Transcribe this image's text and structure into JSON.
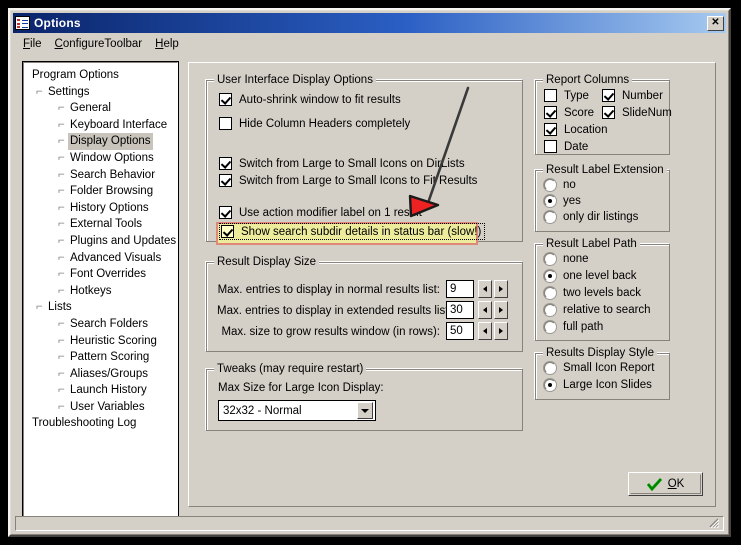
{
  "window": {
    "title": "Options",
    "icon": "options-list-icon",
    "close_label": "✕"
  },
  "menubar": {
    "items": [
      {
        "label": "File",
        "accel": "F"
      },
      {
        "label": "ConfigureToolbar",
        "accel": "C"
      },
      {
        "label": "Help",
        "accel": "H"
      }
    ]
  },
  "tree": {
    "nodes": [
      {
        "label": "Program Options",
        "level": 0,
        "selected": false
      },
      {
        "label": "Settings",
        "level": 1,
        "selected": false
      },
      {
        "label": "General",
        "level": 2,
        "selected": false
      },
      {
        "label": "Keyboard Interface",
        "level": 2,
        "selected": false
      },
      {
        "label": "Display Options",
        "level": 2,
        "selected": true
      },
      {
        "label": "Window Options",
        "level": 2,
        "selected": false
      },
      {
        "label": "Search Behavior",
        "level": 2,
        "selected": false
      },
      {
        "label": "Folder Browsing",
        "level": 2,
        "selected": false
      },
      {
        "label": "History Options",
        "level": 2,
        "selected": false
      },
      {
        "label": "External Tools",
        "level": 2,
        "selected": false
      },
      {
        "label": "Plugins and Updates",
        "level": 2,
        "selected": false
      },
      {
        "label": "Advanced Visuals",
        "level": 2,
        "selected": false
      },
      {
        "label": "Font Overrides",
        "level": 2,
        "selected": false
      },
      {
        "label": "Hotkeys",
        "level": 2,
        "selected": false
      },
      {
        "label": "Lists",
        "level": 1,
        "selected": false
      },
      {
        "label": "Search Folders",
        "level": 2,
        "selected": false
      },
      {
        "label": "Heuristic Scoring",
        "level": 2,
        "selected": false
      },
      {
        "label": "Pattern Scoring",
        "level": 2,
        "selected": false
      },
      {
        "label": "Aliases/Groups",
        "level": 2,
        "selected": false
      },
      {
        "label": "Launch History",
        "level": 2,
        "selected": false
      },
      {
        "label": "User Variables",
        "level": 2,
        "selected": false
      },
      {
        "label": "Troubleshooting Log",
        "level": 0,
        "selected": false
      }
    ]
  },
  "ui_display_options": {
    "caption": "User Interface Display Options",
    "checkboxes": [
      {
        "label": "Auto-shrink window to fit results",
        "checked": true
      },
      {
        "label": "Hide Column Headers completely",
        "checked": false
      },
      {
        "label": "Switch from Large to Small Icons on DirLists",
        "checked": true
      },
      {
        "label": "Switch from Large to Small Icons to Fit Results",
        "checked": true
      },
      {
        "label": "Use action modifier label on 1 result",
        "checked": true
      }
    ],
    "highlighted_option": {
      "label": "Show search subdir details in status bar (slow!)",
      "checked": true,
      "highlight_fill": "#ecec9c",
      "highlight_border": "#e08878"
    }
  },
  "result_display_size": {
    "caption": "Result Display Size",
    "fields": [
      {
        "label": "Max. entries to display in normal results list:",
        "value": "9"
      },
      {
        "label": "Max. entries to display in extended results list:",
        "value": "30"
      },
      {
        "label": "Max. size to grow results window (in rows):",
        "value": "50"
      }
    ]
  },
  "tweaks": {
    "caption": "Tweaks (may require restart)",
    "label": "Max Size for Large Icon Display:",
    "combo_value": "32x32 - Normal"
  },
  "report_columns": {
    "caption": "Report Columns",
    "items": [
      {
        "label": "Type",
        "checked": false
      },
      {
        "label": "Number",
        "checked": true
      },
      {
        "label": "Score",
        "checked": true
      },
      {
        "label": "SlideNum",
        "checked": true
      },
      {
        "label": "Location",
        "checked": true
      },
      {
        "label": "Date",
        "checked": false
      }
    ]
  },
  "result_label_extension": {
    "caption": "Result Label Extension",
    "options": [
      "no",
      "yes",
      "only dir listings"
    ],
    "selected": "yes"
  },
  "result_label_path": {
    "caption": "Result Label Path",
    "options": [
      "none",
      "one level back",
      "two levels back",
      "relative to search",
      "full path"
    ],
    "selected": "one level back"
  },
  "results_display_style": {
    "caption": "Results Display Style",
    "options": [
      "Small Icon Report",
      "Large Icon Slides"
    ],
    "selected": "Large Icon Slides"
  },
  "footer": {
    "ok_label": "OK",
    "ok_accel": "O",
    "ok_icon": "green-check-icon"
  },
  "annotation": {
    "type": "red-arrow",
    "points_to": "Show search subdir details in status bar (slow!)",
    "color": "#ee2222"
  }
}
